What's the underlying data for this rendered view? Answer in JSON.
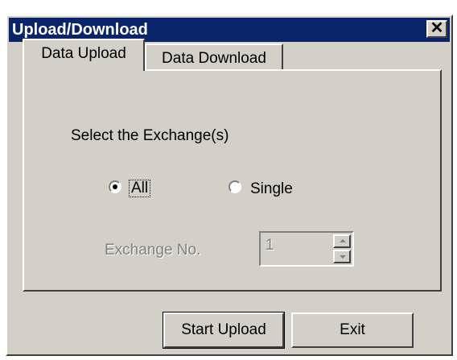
{
  "window": {
    "title": "Upload/Download",
    "close_label": "✕"
  },
  "tabs": [
    {
      "label": "Data Upload",
      "selected": true
    },
    {
      "label": "Data Download",
      "selected": false
    }
  ],
  "panel": {
    "select_label": "Select the Exchange(s)",
    "radio_all_label": "All",
    "radio_single_label": "Single",
    "selected_option": "All",
    "exchange_label": "Exchange No.",
    "exchange_value": "1",
    "exchange_disabled": true
  },
  "buttons": {
    "start_label": "Start Upload",
    "exit_label": "Exit"
  },
  "colors": {
    "title_bar": "#0a246a",
    "face": "#d4d0c8"
  }
}
